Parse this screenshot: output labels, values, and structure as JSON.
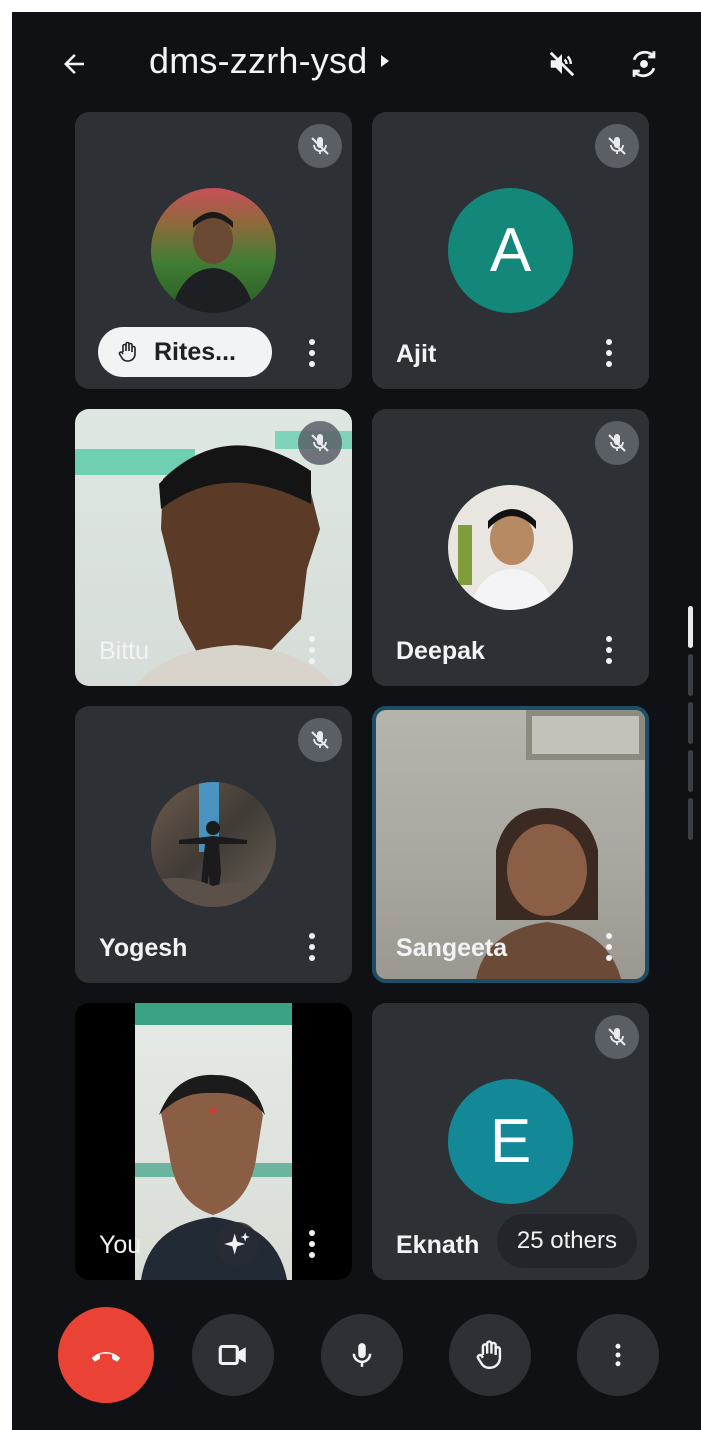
{
  "header": {
    "meeting_code": "dms-zzrh-ysd"
  },
  "participants": [
    {
      "name": "Rites...",
      "hand_raised": true,
      "muted": true,
      "view": "avatar-photo"
    },
    {
      "name": "Ajit",
      "initial": "A",
      "avatar_color": "#12877a",
      "muted": true,
      "view": "avatar-initial"
    },
    {
      "name": "Bittu",
      "muted": true,
      "view": "video"
    },
    {
      "name": "Deepak",
      "muted": true,
      "view": "avatar-photo"
    },
    {
      "name": "Yogesh",
      "muted": true,
      "view": "avatar-photo"
    },
    {
      "name": "Sangeeta",
      "muted": false,
      "active_speaker": true,
      "view": "video"
    },
    {
      "name": "You",
      "muted": false,
      "view": "video",
      "effects_icon": "sparkle-icon"
    },
    {
      "name": "Eknath",
      "initial": "E",
      "avatar_color": "#138896",
      "muted": true,
      "view": "avatar-initial"
    }
  ],
  "others": {
    "label": "25 others"
  },
  "controls": [
    "end-call",
    "camera",
    "microphone",
    "raise-hand",
    "more-options"
  ],
  "colors": {
    "end_call": "#ea4335",
    "tile_bg": "#2d3136",
    "active_border": "#1d4e66"
  }
}
